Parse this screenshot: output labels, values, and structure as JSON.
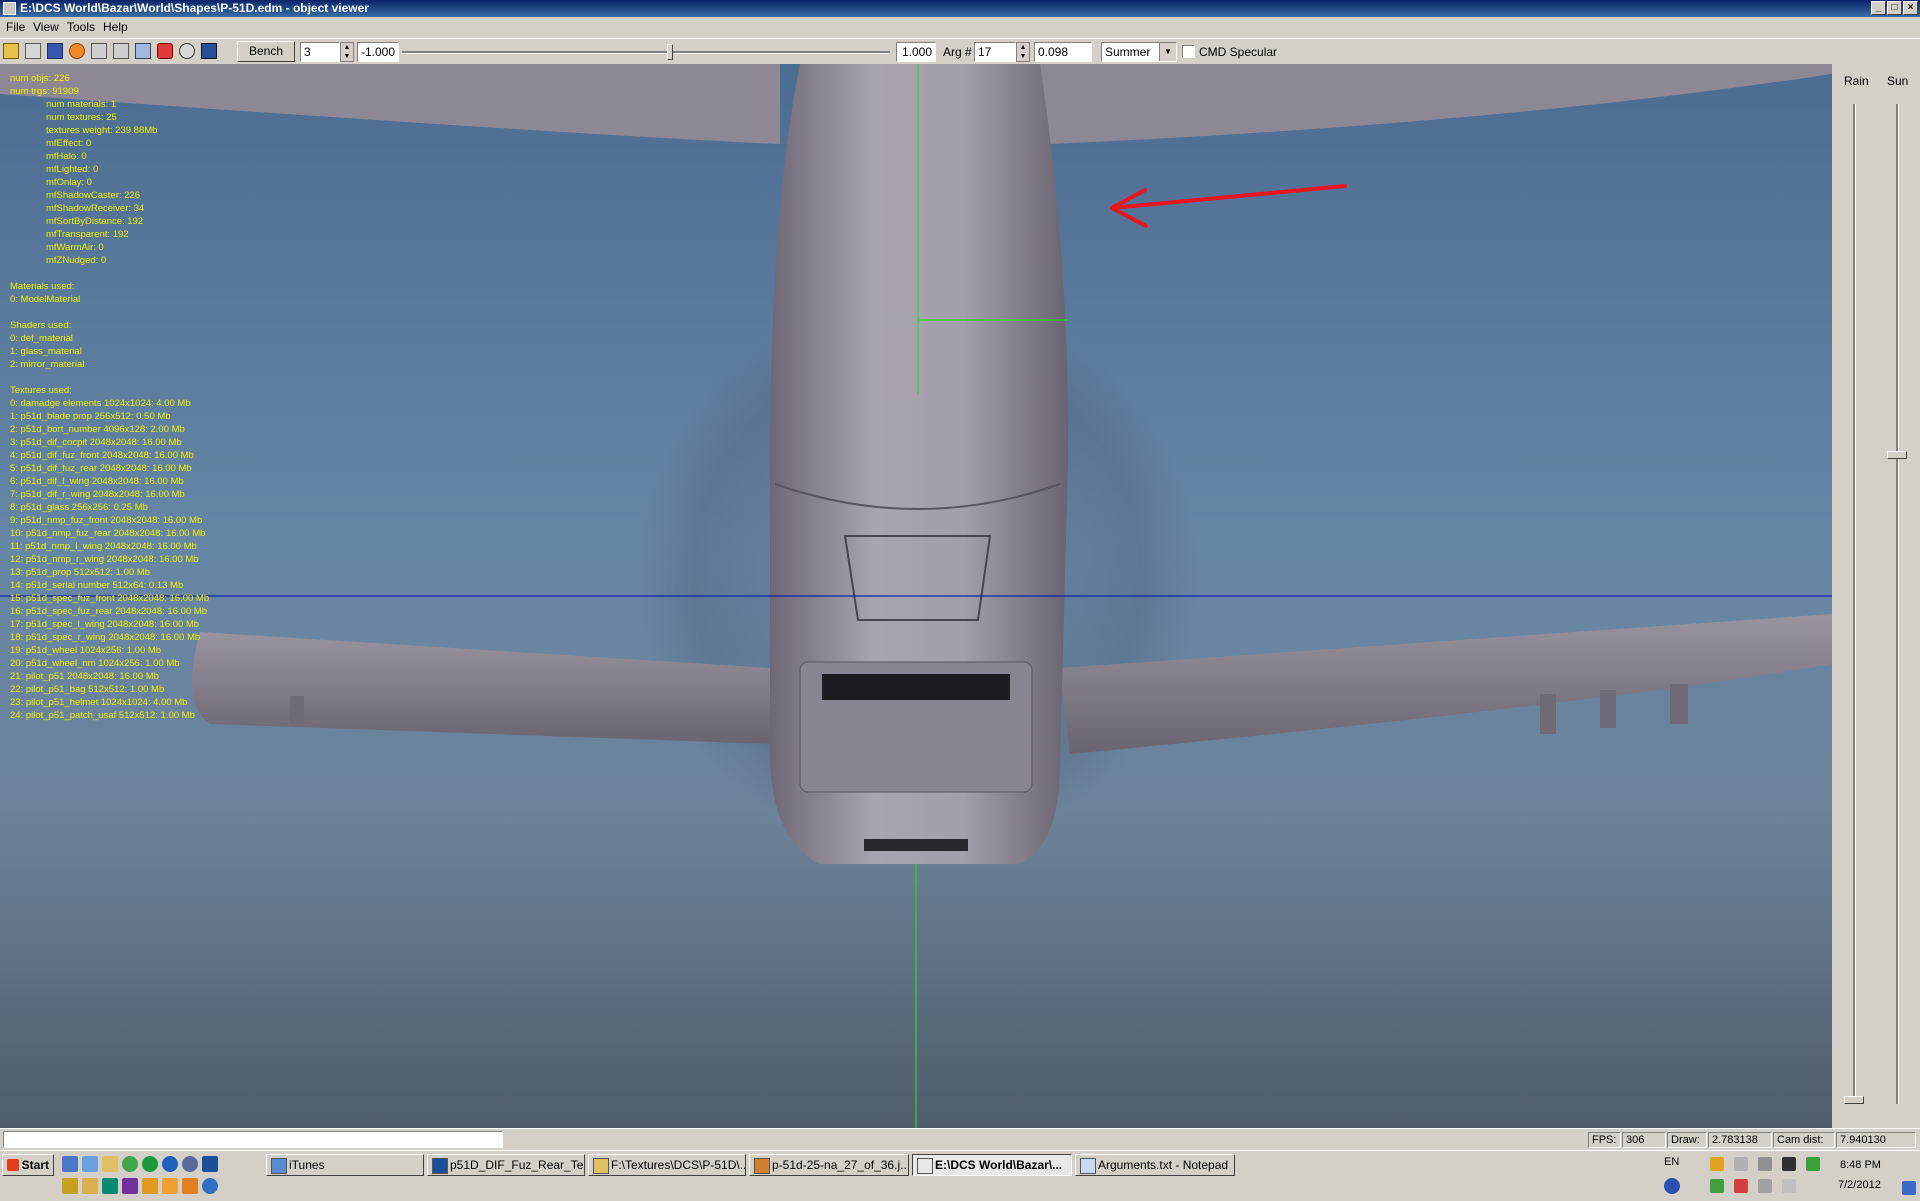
{
  "window": {
    "title": "E:\\DCS World\\Bazar\\World\\Shapes\\P-51D.edm - object viewer",
    "minimize_glyph": "_",
    "maximize_glyph": "□",
    "close_glyph": "×"
  },
  "menu": {
    "items": [
      "File",
      "View",
      "Tools",
      "Help"
    ]
  },
  "toolbar": {
    "bench_label": "Bench",
    "bench_value": "3",
    "slider_min_value": "-1.000",
    "slider_value": "1.000",
    "slider_position": 0.55,
    "arg_label": "Arg #",
    "arg_value": "17",
    "arg_result": "0.098",
    "season": "Summer",
    "cmd_specular_label": "CMD Specular",
    "cmd_specular_checked": false,
    "icons": [
      "open-icon",
      "save-icon",
      "export-icon",
      "animate-icon",
      "undo-icon",
      "redo-icon",
      "graph-icon",
      "figure-icon",
      "find-icon",
      "options-icon"
    ]
  },
  "stats": {
    "lines_top": [
      "num objs: 226",
      "num trgs: 91909"
    ],
    "lines_indented": [
      "num materials: 1",
      "num textures: 25",
      "textures weight: 239.88Mb",
      "mfEffect: 0",
      "mfHalo: 0",
      "mfLighted: 0",
      "mfOnlay: 0",
      "mfShadowCaster: 226",
      "mfShadowReceiver: 34",
      "mfSortByDistance: 192",
      "mfTransparent: 192",
      "mfWarmAir: 0",
      "mfZNudged: 0"
    ],
    "materials_header": "Materials used:",
    "materials": [
      "0: ModelMaterial"
    ],
    "shaders_header": "Shaders used:",
    "shaders": [
      "0: def_material",
      "1: glass_material",
      "2: mirror_material"
    ],
    "textures_header": "Textures used:",
    "textures": [
      "0: damadge elements 1024x1024: 4.00 Mb",
      "1: p51d_blade prop 256x512: 0.50 Mb",
      "2: p51d_bort_number 4096x128: 2.00 Mb",
      "3: p51d_dif_cocpit 2048x2048: 16.00 Mb",
      "4: p51d_dif_fuz_front 2048x2048: 16.00 Mb",
      "5: p51d_dif_fuz_rear 2048x2048: 16.00 Mb",
      "6: p51d_dif_l_wing 2048x2048: 16.00 Mb",
      "7: p51d_dif_r_wing 2048x2048: 16.00 Mb",
      "8: p51d_glass 256x256: 0.25 Mb",
      "9: p51d_nmp_fuz_front 2048x2048: 16.00 Mb",
      "10: p51d_nmp_fuz_rear 2048x2048: 16.00 Mb",
      "11: p51d_nmp_l_wing 2048x2048: 16.00 Mb",
      "12: p51d_nmp_r_wing 2048x2048: 16.00 Mb",
      "13: p51d_prop 512x512: 1.00 Mb",
      "14: p51d_serial number 512x64: 0.13 Mb",
      "15: p51d_spec_fuz_front 2048x2048: 16.00 Mb",
      "16: p51d_spec_fuz_rear 2048x2048: 16.00 Mb",
      "17: p51d_spec_l_wing 2048x2048: 16.00 Mb",
      "18: p51d_spec_r_wing 2048x2048: 16.00 Mb",
      "19: p51d_wheel 1024x256: 1.00 Mb",
      "20: p51d_wheel_nm 1024x256: 1.00 Mb",
      "21: pilot_p51 2048x2048: 16.00 Mb",
      "22: pilot_p51_bag 512x512: 1.00 Mb",
      "23: pilot_p51_helmet 1024x1024: 4.00 Mb",
      "24: pilot_p51_patch_usaf 512x512: 1.00 Mb"
    ]
  },
  "right_panel": {
    "rain_label": "Rain",
    "sun_label": "Sun",
    "rain_level": 0.0,
    "sun_level": 0.65
  },
  "statusbar": {
    "command_value": "",
    "fps_label": "FPS:",
    "fps_value": "306",
    "draw_label": "Draw:",
    "draw_value": "2.783138",
    "camdist_label": "Cam dist:",
    "camdist_value": "7.940130"
  },
  "taskbar": {
    "start_label": "Start",
    "tasks": [
      {
        "label": "iTunes",
        "icon": "itunes-icon",
        "active": false
      },
      {
        "label": "p51D_DIF_Fuz_Rear_Te...",
        "icon": "photoshop-icon",
        "active": false
      },
      {
        "label": "F:\\Textures\\DCS\\P-51D\\...",
        "icon": "folder-icon",
        "active": false
      },
      {
        "label": "p-51d-25-na_27_of_36.j...",
        "icon": "image-viewer-icon",
        "active": false
      },
      {
        "label": "E:\\DCS World\\Bazar\\...",
        "icon": "object-viewer-icon",
        "active": true
      },
      {
        "label": "Arguments.txt - Notepad",
        "icon": "notepad-icon",
        "active": false
      }
    ],
    "language": "EN",
    "time": "8:48 PM",
    "date": "7/2/2012",
    "colors": {
      "start_flag_red": "#e33b1d",
      "annotation_arrow": "#e8141e",
      "overlay_text": "#f0f000"
    }
  }
}
